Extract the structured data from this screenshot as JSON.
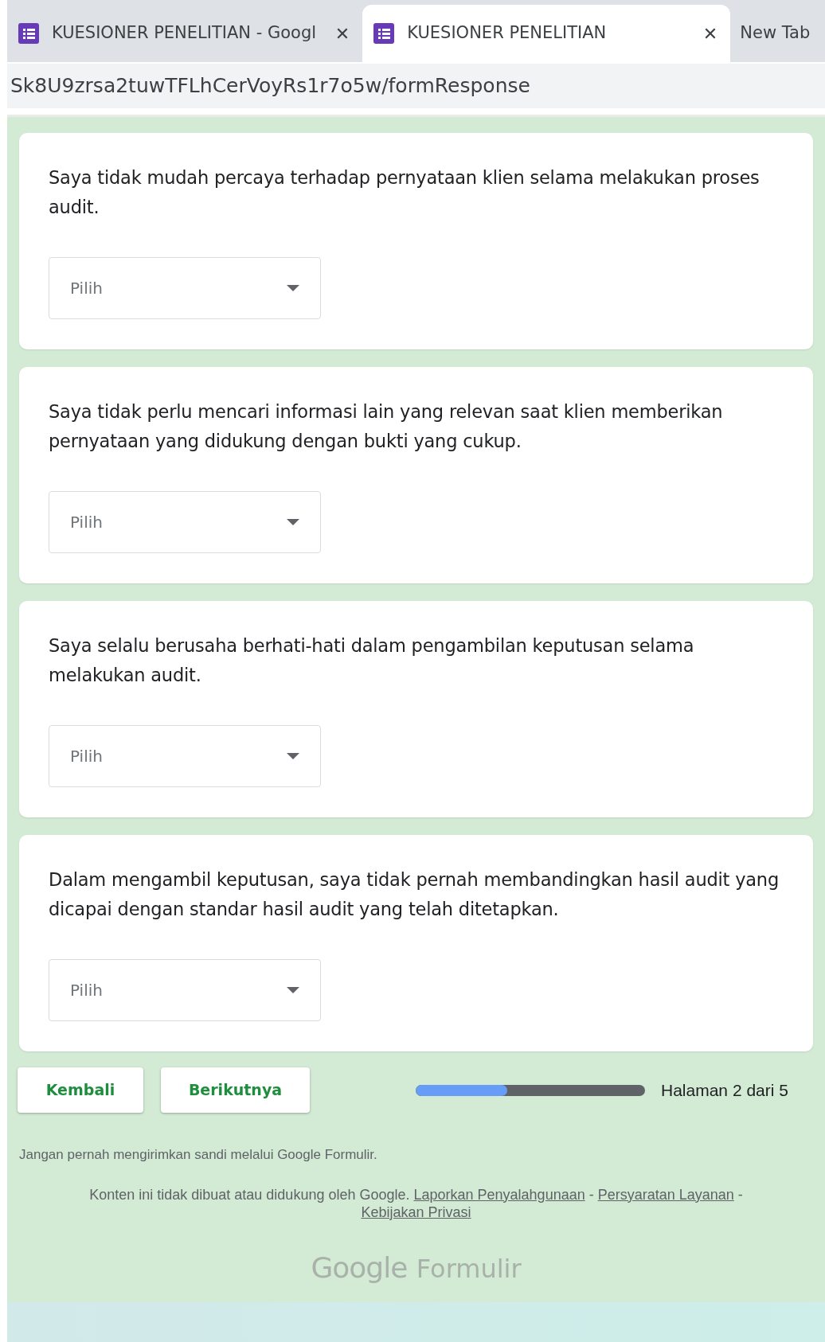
{
  "browser": {
    "tabs": [
      {
        "title": "KUESIONER PENELITIAN - Googl",
        "selected": false
      },
      {
        "title": "KUESIONER PENELITIAN",
        "selected": true
      },
      {
        "title": "New Tab",
        "selected": false
      }
    ],
    "close_glyph": "✕",
    "address": "Sk8U9zrsa2tuwTFLhCerVoyRs1r7o5w/formResponse"
  },
  "questions": [
    {
      "text": "Saya tidak mudah percaya terhadap pernyataan klien selama melakukan proses audit.",
      "dropdown": {
        "placeholder": "Pilih"
      }
    },
    {
      "text": "Saya tidak perlu mencari informasi lain yang relevan saat klien memberikan pernyataan yang didukung dengan bukti yang cukup.",
      "dropdown": {
        "placeholder": "Pilih"
      }
    },
    {
      "text": "Saya selalu berusaha berhati-hati dalam pengambilan keputusan selama melakukan audit.",
      "dropdown": {
        "placeholder": "Pilih"
      }
    },
    {
      "text": "Dalam mengambil keputusan, saya tidak pernah membandingkan hasil audit yang dicapai dengan standar hasil audit yang telah ditetapkan.",
      "dropdown": {
        "placeholder": "Pilih"
      }
    }
  ],
  "nav_buttons": [
    "Kembali",
    "Berikutnya"
  ],
  "progress": {
    "level": 0.4,
    "label": "Halaman 2 dari 5"
  },
  "footer": {
    "warning": "Jangan pernah mengirimkan sandi melalui Google Formulir.",
    "disclaimer": "Konten ini tidak dibuat atau didukung oleh Google.",
    "links": [
      "Laporkan Penyalahgunaan",
      "Persyaratan Layanan",
      "Kebijakan Privasi"
    ],
    "separator": "-",
    "logo": [
      "Google",
      "Formulir"
    ]
  }
}
